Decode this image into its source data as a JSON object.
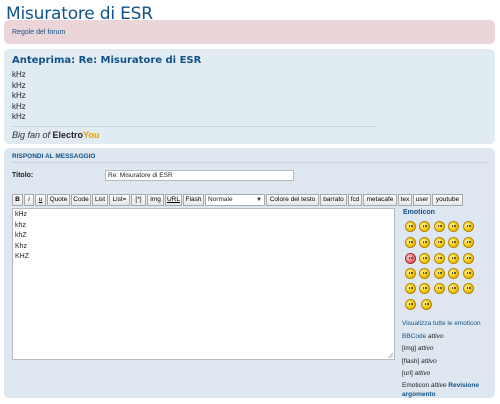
{
  "page": {
    "title": "Misuratore di ESR"
  },
  "rules": {
    "link_label": "Regole del forum"
  },
  "preview": {
    "title": "Anteprima: Re: Misuratore di ESR",
    "lines": [
      "kHz",
      "kHz",
      "kHz",
      "kHz",
      "kHz"
    ],
    "signature_prefix": "Big fan of",
    "signature_logo_a": "ElectroYou",
    "logo_e": "Electro",
    "logo_y": "You"
  },
  "reply": {
    "header": "RISPONDI AL MESSAGGIO",
    "titolo_label": "Titolo:",
    "titolo_value": "Re: Misuratore di ESR",
    "toolbar": [
      "B",
      "i",
      "u",
      "Quote",
      "Code",
      "List",
      "List=",
      "[*]",
      "Img",
      "URL",
      "Flash",
      "Colore del testo",
      "barrato",
      "fcd",
      "metacafe",
      "tex",
      "user",
      "youtube"
    ],
    "font_size_select": "Normale",
    "textarea_lines": [
      "kHz",
      "khz",
      "khZ",
      "Khz",
      "KHZ"
    ]
  },
  "emoticons": {
    "title": "Emoticon",
    "icons": [
      "smile-icon",
      "wink-icon",
      "neutral-icon",
      "sad-icon",
      "laugh-icon",
      "cool-icon",
      "eek-icon",
      "confused-icon",
      "grin-icon",
      "biggrin-icon",
      "angry-icon",
      "surprised-icon",
      "shocked-icon",
      "evil-icon",
      "razz-icon",
      "mad-icon",
      "exclaim-icon",
      "question-icon",
      "idea-icon",
      "arrow-icon",
      "rolleyes-icon",
      "twisted-icon",
      "mrgreen-icon",
      "redface-icon",
      "cry-icon",
      "lol-icon",
      "thinking-icon",
      "dance-icon"
    ]
  },
  "side": {
    "all_emoticons": "Visualizza tutte le emoticon",
    "bbcode_label": "BBCode",
    "bbcode_state": "attivo",
    "img_label": "[img]",
    "img_state": "attivo",
    "flash_label": "[flash]",
    "flash_state": "attivo",
    "url_label": "[url]",
    "url_state": "attivo",
    "emoticon_label": "Emoticon",
    "emoticon_state": "attive",
    "review_link": "Revisione argomento"
  },
  "colors": {
    "link": "#105289",
    "rules_bg": "#ecd5d8",
    "panel_bg": "#e1ebf2",
    "reply_bg": "#dee7ef"
  }
}
